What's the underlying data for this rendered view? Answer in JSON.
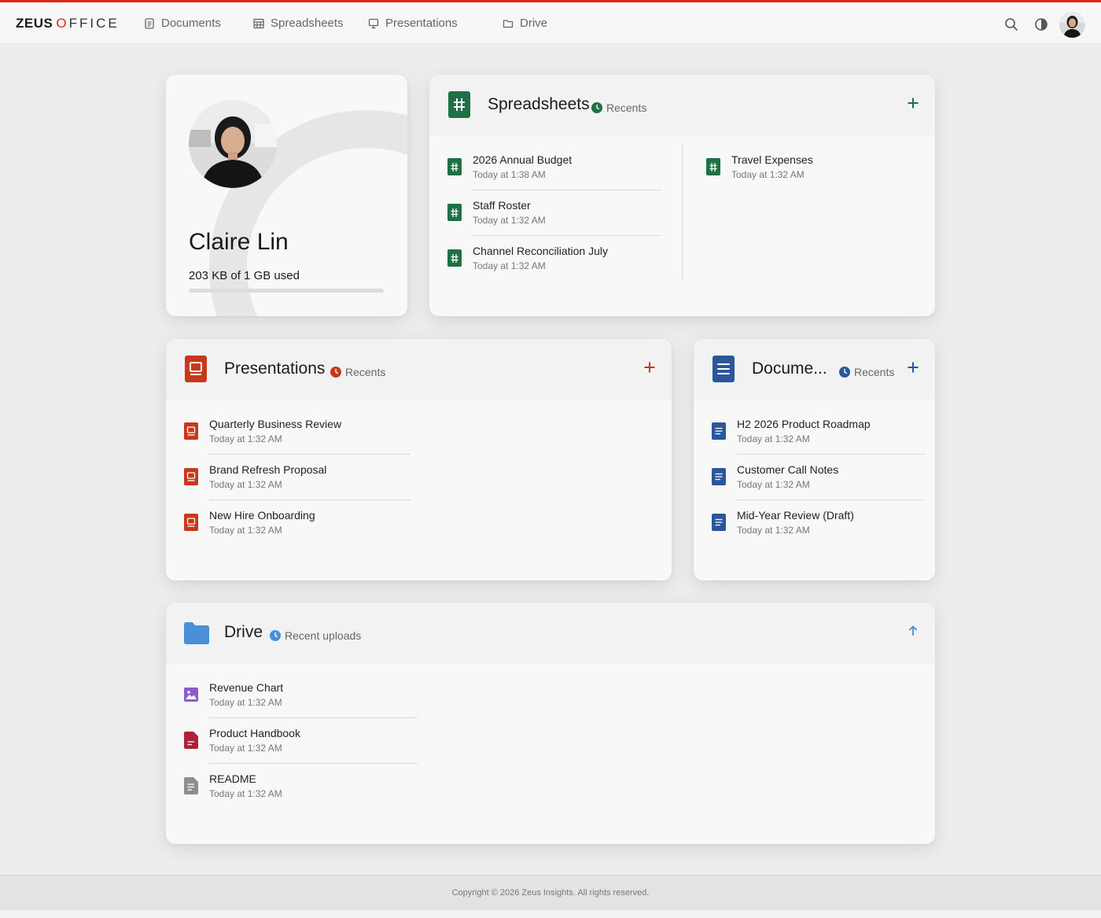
{
  "brand": {
    "part1": "ZEUS",
    "part2": "O",
    "part3": "FFICE"
  },
  "nav": [
    {
      "label": "Documents",
      "icon": "document-icon"
    },
    {
      "label": "Spreadsheets",
      "icon": "table-icon"
    },
    {
      "label": "Presentations",
      "icon": "monitor-icon"
    },
    {
      "label": "Drive",
      "icon": "folder-icon"
    }
  ],
  "colors": {
    "accent": "#e2231a",
    "sheets": "#1e7145",
    "presentations": "#c8391b",
    "documents": "#2b579a",
    "drive": "#4a90d9"
  },
  "profile": {
    "name": "Claire Lin",
    "usage": "203 KB of 1 GB used",
    "usage_fraction": 0.0002
  },
  "spreadsheets": {
    "title": "Spreadsheets",
    "subtitle": "Recents",
    "items_left": [
      {
        "name": "2026 Annual Budget",
        "date": "Today at 1:38 AM"
      },
      {
        "name": "Staff Roster",
        "date": "Today at 1:32 AM"
      },
      {
        "name": "Channel Reconciliation July",
        "date": "Today at 1:32 AM"
      }
    ],
    "items_right": [
      {
        "name": "Travel Expenses",
        "date": "Today at 1:32 AM"
      }
    ]
  },
  "presentations": {
    "title": "Presentations",
    "subtitle": "Recents",
    "items": [
      {
        "name": "Quarterly Business Review",
        "date": "Today at 1:32 AM"
      },
      {
        "name": "Brand Refresh Proposal",
        "date": "Today at 1:32 AM"
      },
      {
        "name": "New Hire Onboarding",
        "date": "Today at 1:32 AM"
      }
    ]
  },
  "documents": {
    "title": "Docume...",
    "subtitle": "Recents",
    "items": [
      {
        "name": "H2 2026 Product Roadmap",
        "date": "Today at 1:32 AM"
      },
      {
        "name": "Customer Call Notes",
        "date": "Today at 1:32 AM"
      },
      {
        "name": "Mid-Year Review (Draft)",
        "date": "Today at 1:32 AM"
      }
    ]
  },
  "drive": {
    "title": "Drive",
    "subtitle": "Recent uploads",
    "items": [
      {
        "name": "Revenue Chart",
        "date": "Today at 1:32 AM",
        "icon": "image-file-icon"
      },
      {
        "name": "Product Handbook",
        "date": "Today at 1:32 AM",
        "icon": "pdf-file-icon"
      },
      {
        "name": "README",
        "date": "Today at 1:32 AM",
        "icon": "text-file-icon"
      }
    ]
  },
  "footer": {
    "copyright": "Copyright © 2026 Zeus Insights. All rights reserved."
  }
}
